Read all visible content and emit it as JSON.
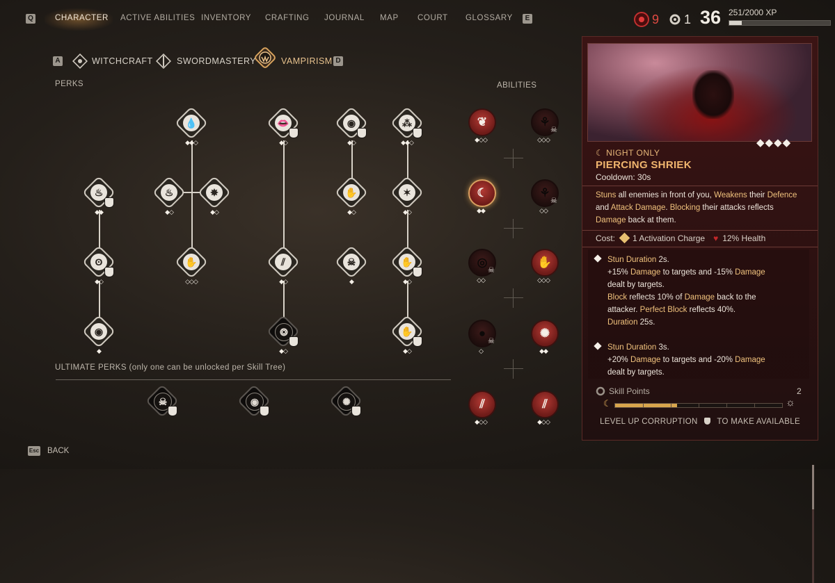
{
  "nav": {
    "left_key": "Q",
    "right_key": "E",
    "tabs": [
      "CHARACTER",
      "ACTIVE ABILITIES",
      "INVENTORY",
      "CRAFTING",
      "JOURNAL",
      "MAP",
      "COURT",
      "GLOSSARY"
    ],
    "active_tab": "CHARACTER"
  },
  "stats": {
    "blood_count": "9",
    "points_count": "1",
    "level": "36",
    "xp_text": "251/2000 XP",
    "xp_fraction": 0.1255
  },
  "tree_tabs": {
    "left_key": "A",
    "right_key": "D",
    "items": [
      "WITCHCRAFT",
      "SWORDMASTERY",
      "VAMPIRISM"
    ],
    "active": "VAMPIRISM"
  },
  "sections": {
    "perks": "PERKS",
    "abilities": "ABILITIES",
    "ultimate": "ULTIMATE PERKS (only one can be unlocked per Skill Tree)"
  },
  "perks": [
    {
      "glyph": "💧",
      "pips": "◆◆◇",
      "fang": false
    },
    {
      "glyph": "👄",
      "pips": "◆◇",
      "fang": true
    },
    {
      "glyph": "◉",
      "pips": "◆◇",
      "fang": true
    },
    {
      "glyph": "⁂",
      "pips": "◆◆◇",
      "fang": true
    },
    {
      "glyph": "♨",
      "pips": "◆◆",
      "fang": true
    },
    {
      "glyph": "♨",
      "pips": "◆◇",
      "fang": false
    },
    {
      "glyph": "✸",
      "pips": "◆◇",
      "fang": false
    },
    {
      "glyph": "✋",
      "pips": "◆◇",
      "fang": false
    },
    {
      "glyph": "✶",
      "pips": "◆◇",
      "fang": false
    },
    {
      "glyph": "ʘ",
      "pips": "◆◇",
      "fang": true
    },
    {
      "glyph": "✋",
      "pips": "◇◇◇",
      "fang": false
    },
    {
      "glyph": "⫽",
      "pips": "◆◇",
      "fang": false
    },
    {
      "glyph": "☠",
      "pips": "◆",
      "fang": false
    },
    {
      "glyph": "✋",
      "pips": "◆◇",
      "fang": true
    },
    {
      "glyph": "❂",
      "pips": "◆◇",
      "fang": true
    },
    {
      "glyph": "◉",
      "pips": "◆",
      "fang": false
    },
    {
      "glyph": "✋",
      "pips": "◆◇",
      "fang": true
    }
  ],
  "ultimates": [
    {
      "glyph": "☠"
    },
    {
      "glyph": "◉"
    },
    {
      "glyph": "✺"
    }
  ],
  "abilities": [
    {
      "glyph": "❦",
      "pips": "◆◇◇",
      "state": "active",
      "skull": false
    },
    {
      "glyph": "⚘",
      "pips": "◇◇◇",
      "state": "dim",
      "skull": true
    },
    {
      "glyph": "☾",
      "pips": "◆◆",
      "state": "selected",
      "skull": false
    },
    {
      "glyph": "⚘",
      "pips": "◇◇",
      "state": "dim",
      "skull": true
    },
    {
      "glyph": "◎",
      "pips": "◇◇",
      "state": "dim",
      "skull": true
    },
    {
      "glyph": "✋",
      "pips": "◇◇◇",
      "state": "active",
      "skull": false
    },
    {
      "glyph": "●",
      "pips": "◇",
      "state": "dim",
      "skull": true
    },
    {
      "glyph": "✺",
      "pips": "◆◆",
      "state": "active",
      "skull": false
    },
    {
      "glyph": "⫽",
      "pips": "◆◇◇",
      "state": "active",
      "skull": false
    },
    {
      "glyph": "⫽",
      "pips": "◆◇◇",
      "state": "active",
      "skull": false
    }
  ],
  "detail": {
    "rank_pips": "◆◆◆◆",
    "tag": "☾ NIGHT ONLY",
    "title": "PIERCING SHRIEK",
    "cooldown": "Cooldown: 30s",
    "desc": [
      {
        "t": "Stuns",
        "h": true
      },
      {
        "t": " all enemies in front of you, ",
        "h": false
      },
      {
        "t": "Weakens",
        "h": true
      },
      {
        "t": " their ",
        "h": false
      },
      {
        "t": "Defence",
        "h": true
      },
      {
        "t": " and ",
        "h": false
      },
      {
        "t": "Attack Damage",
        "h": true
      },
      {
        "t": ". ",
        "h": false
      },
      {
        "t": "Blocking",
        "h": true
      },
      {
        "t": " their attacks reflects ",
        "h": false
      },
      {
        "t": "Damage",
        "h": true
      },
      {
        "t": " back at them.",
        "h": false
      }
    ],
    "cost_label": "Cost:",
    "cost_charge": "1 Activation Charge",
    "cost_health": "12% Health",
    "upgrades": [
      {
        "lines": [
          [
            {
              "t": "Stun Duration",
              "h": true
            },
            {
              "t": " 2s.",
              "h": false
            }
          ],
          [
            {
              "t": "+15% ",
              "h": false
            },
            {
              "t": "Damage",
              "h": true
            },
            {
              "t": " to targets and -15% ",
              "h": false
            },
            {
              "t": "Damage",
              "h": true
            }
          ],
          [
            {
              "t": "dealt by targets.",
              "h": false
            }
          ],
          [
            {
              "t": "Block",
              "h": true
            },
            {
              "t": " reflects 10% of ",
              "h": false
            },
            {
              "t": "Damage",
              "h": true
            },
            {
              "t": " back to the",
              "h": false
            }
          ],
          [
            {
              "t": "attacker. ",
              "h": false
            },
            {
              "t": "Perfect Block",
              "h": true
            },
            {
              "t": " reflects 40%.",
              "h": false
            }
          ],
          [
            {
              "t": "Duration",
              "h": true
            },
            {
              "t": " 25s.",
              "h": false
            }
          ]
        ]
      },
      {
        "lines": [
          [
            {
              "t": "Stun Duration",
              "h": true
            },
            {
              "t": " 3s.",
              "h": false
            }
          ],
          [
            {
              "t": "+20% ",
              "h": false
            },
            {
              "t": "Damage",
              "h": true
            },
            {
              "t": " to targets and -20% ",
              "h": false
            },
            {
              "t": "Damage",
              "h": true
            }
          ],
          [
            {
              "t": "dealt by targets.",
              "h": false
            }
          ]
        ]
      }
    ],
    "skill_points_label": "Skill Points",
    "skill_points_value": "2",
    "corruption_fraction": 0.37,
    "level_up_text_a": "LEVEL UP CORRUPTION",
    "level_up_text_b": "TO MAKE AVAILABLE"
  },
  "footer": {
    "back_key": "Esc",
    "back_label": "BACK"
  },
  "colors": {
    "accent_gold": "#e7c28e",
    "highlight": "#f0c27d",
    "blood_red": "#b23a34",
    "panel": "#3b1414"
  }
}
